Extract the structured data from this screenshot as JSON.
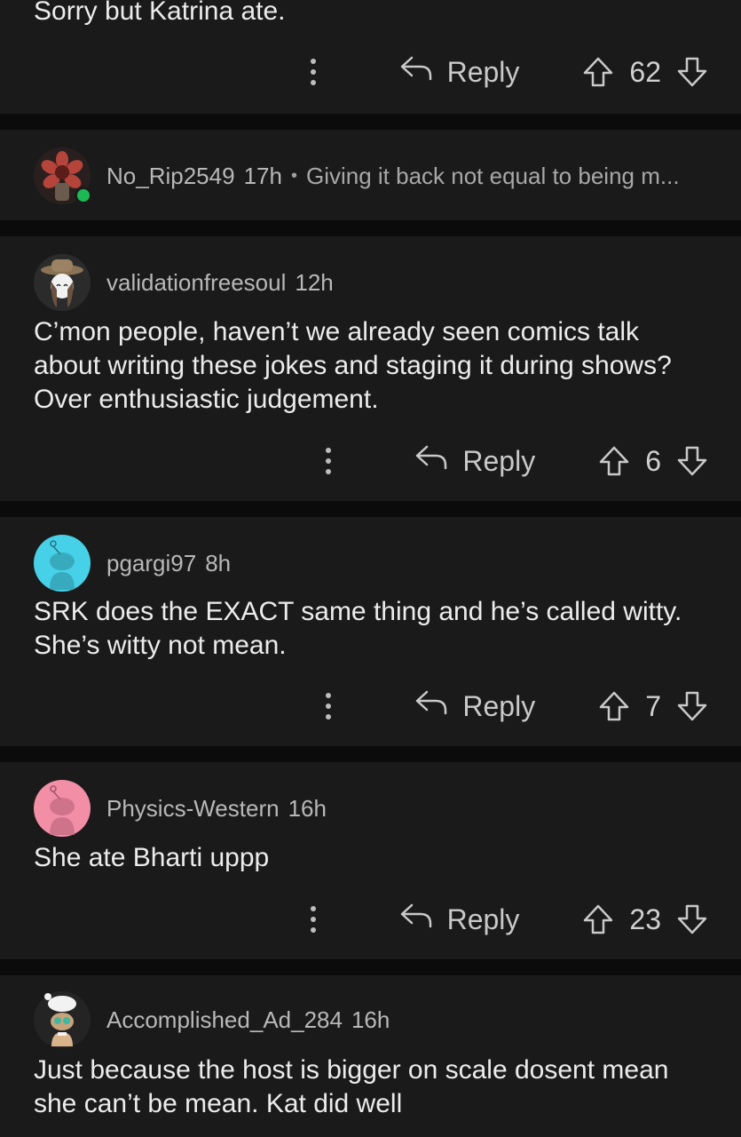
{
  "comments": [
    {
      "body": "Sorry but Katrina ate.",
      "reply_label": "Reply",
      "score": "62"
    },
    {
      "username": "No_Rip2549",
      "time": "17h",
      "separator": "•",
      "preview": "Giving it back not equal to being m...",
      "collapsed": true
    },
    {
      "username": "validationfreesoul",
      "time": "12h",
      "body": "C’mon people, haven’t we already seen comics talk about writing these jokes and staging it during shows? Over enthusiastic judgement.",
      "reply_label": "Reply",
      "score": "6"
    },
    {
      "username": "pgargi97",
      "time": "8h",
      "body": "SRK does the EXACT same thing and he’s called witty. She’s witty not mean.",
      "reply_label": "Reply",
      "score": "7",
      "avatar_color": "#46d1e8"
    },
    {
      "username": "Physics-Western",
      "time": "16h",
      "body": "She ate Bharti uppp",
      "reply_label": "Reply",
      "score": "23",
      "avatar_color": "#f28fa6"
    },
    {
      "username": "Accomplished_Ad_284",
      "time": "16h",
      "body": "Just because the host is bigger on scale dosent mean she can’t be mean. Kat did well"
    }
  ],
  "colors": {
    "background": "#0b0b0b",
    "card": "#1a1a1b",
    "online": "#1db954"
  }
}
